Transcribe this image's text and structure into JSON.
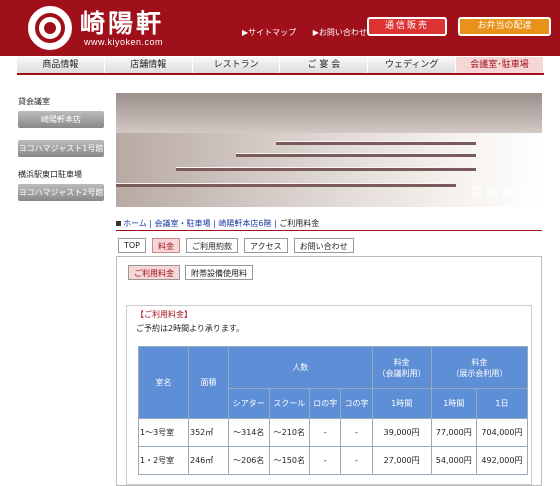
{
  "header": {
    "logo_text": "崎陽軒",
    "url": "www.kiyoken.com",
    "links": [
      "▶サイトマップ",
      "▶お問い合わせ"
    ],
    "btn_mail": "通信販売",
    "btn_bento": "お弁当の配達"
  },
  "gnav": [
    "商品情報",
    "店舗情報",
    "レストラン",
    "ご 宴 会",
    "ウェディング",
    "会議室･駐車場"
  ],
  "sidebar": {
    "label1": "貸会議室",
    "btn1": "崎陽軒本店",
    "btn2": "ヨコハマジャスト1号館",
    "label2": "横浜駅東口駐車場",
    "btn3": "ヨコハマジャスト2号館"
  },
  "hero_caption": "貸会議室",
  "breadcrumb": [
    "ホーム",
    "会議室・駐車場",
    "崎陽軒本店6階",
    "ご利用料金"
  ],
  "tabs": [
    "TOP",
    "料金",
    "ご利用約款",
    "アクセス",
    "お問い合わせ"
  ],
  "subtabs": [
    "ご利用料金",
    "附帯設備使用料"
  ],
  "box": {
    "title": "【ご利用料金】",
    "note": "ご予約は2時間より承ります。"
  },
  "table": {
    "h_room": "室名",
    "h_area": "面積",
    "h_people": "人数",
    "h_fee_meeting": "料金\n（会議利用）",
    "h_fee_party": "料金\n（展示会利用）",
    "sub_theater": "シアター",
    "sub_school": "スクール",
    "sub_ro": "ロの字",
    "sub_ko": "コの字",
    "sub_1h": "1時間",
    "sub_1h2": "1時間",
    "sub_1d": "1日",
    "rows": [
      [
        "1～3号室",
        "352㎡",
        "～314名",
        "～210名",
        "-",
        "-",
        "39,000円",
        "77,000円",
        "704,000円"
      ],
      [
        "1・2号室",
        "246㎡",
        "～206名",
        "～150名",
        "-",
        "-",
        "27,000円",
        "54,000円",
        "492,000円"
      ]
    ]
  }
}
